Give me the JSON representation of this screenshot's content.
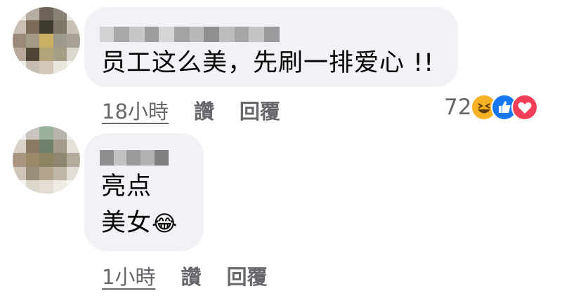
{
  "comments": [
    {
      "text_lines": [
        "员工这么美，先刷一排爱心 !!"
      ],
      "time": "18小時",
      "like_label": "讚",
      "reply_label": "回覆",
      "reactions": {
        "count": "72",
        "icons": [
          "haha-icon",
          "like-icon",
          "love-icon"
        ]
      }
    },
    {
      "text_lines": [
        "亮点",
        "美女"
      ],
      "emoji": "😂",
      "time": "1小時",
      "like_label": "讚",
      "reply_label": "回覆"
    }
  ],
  "colors": {
    "bubble": "#f0f2f5",
    "secondary_text": "#65676b",
    "like_blue": "#1877f2",
    "love_red": "#f33e58",
    "haha_yellow": "#f7b125"
  }
}
